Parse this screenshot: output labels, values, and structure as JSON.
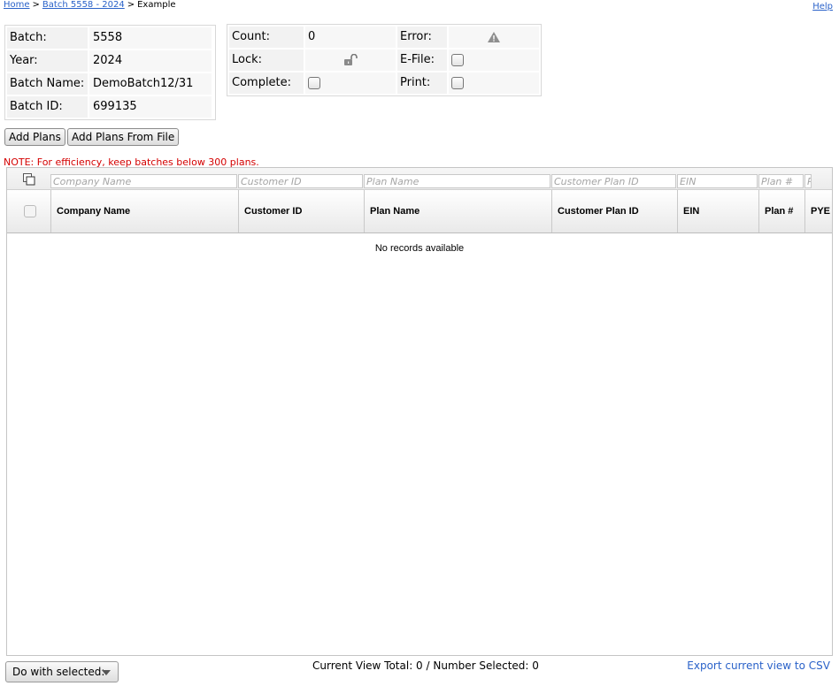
{
  "breadcrumb": {
    "home": "Home",
    "batch": "Batch 5558 - 2024",
    "current": "Example",
    "separator": ">"
  },
  "help": "Help",
  "batch_info": {
    "batch_label": "Batch:",
    "batch_value": "5558",
    "year_label": "Year:",
    "year_value": "2024",
    "name_label": "Batch Name:",
    "name_value": "DemoBatch12/31",
    "id_label": "Batch ID:",
    "id_value": "699135"
  },
  "status": {
    "count_label": "Count:",
    "count_value": "0",
    "error_label": "Error:",
    "lock_label": "Lock:",
    "efile_label": "E-File:",
    "complete_label": "Complete:",
    "print_label": "Print:"
  },
  "buttons": {
    "add_plans": "Add Plans",
    "add_plans_file": "Add Plans From File"
  },
  "note": "NOTE: For efficiency, keep batches below 300 plans.",
  "grid": {
    "filters": [
      "Company Name",
      "Customer ID",
      "Plan Name",
      "Customer Plan ID",
      "EIN",
      "Plan #",
      "P"
    ],
    "columns": [
      "Company Name",
      "Customer ID",
      "Plan Name",
      "Customer Plan ID",
      "EIN",
      "Plan #",
      "PYE"
    ],
    "empty_message": "No records available"
  },
  "footer": {
    "do_with_selected": "Do with selected:",
    "totals": "Current View Total: 0 / Number Selected: 0",
    "export": "Export current view to CSV"
  },
  "icons": {
    "filter": "copy-filter-icon",
    "error": "warning-icon",
    "lock": "unlocked-padlock-icon"
  },
  "colors": {
    "link": "#2a62c9",
    "note": "#d40000"
  }
}
